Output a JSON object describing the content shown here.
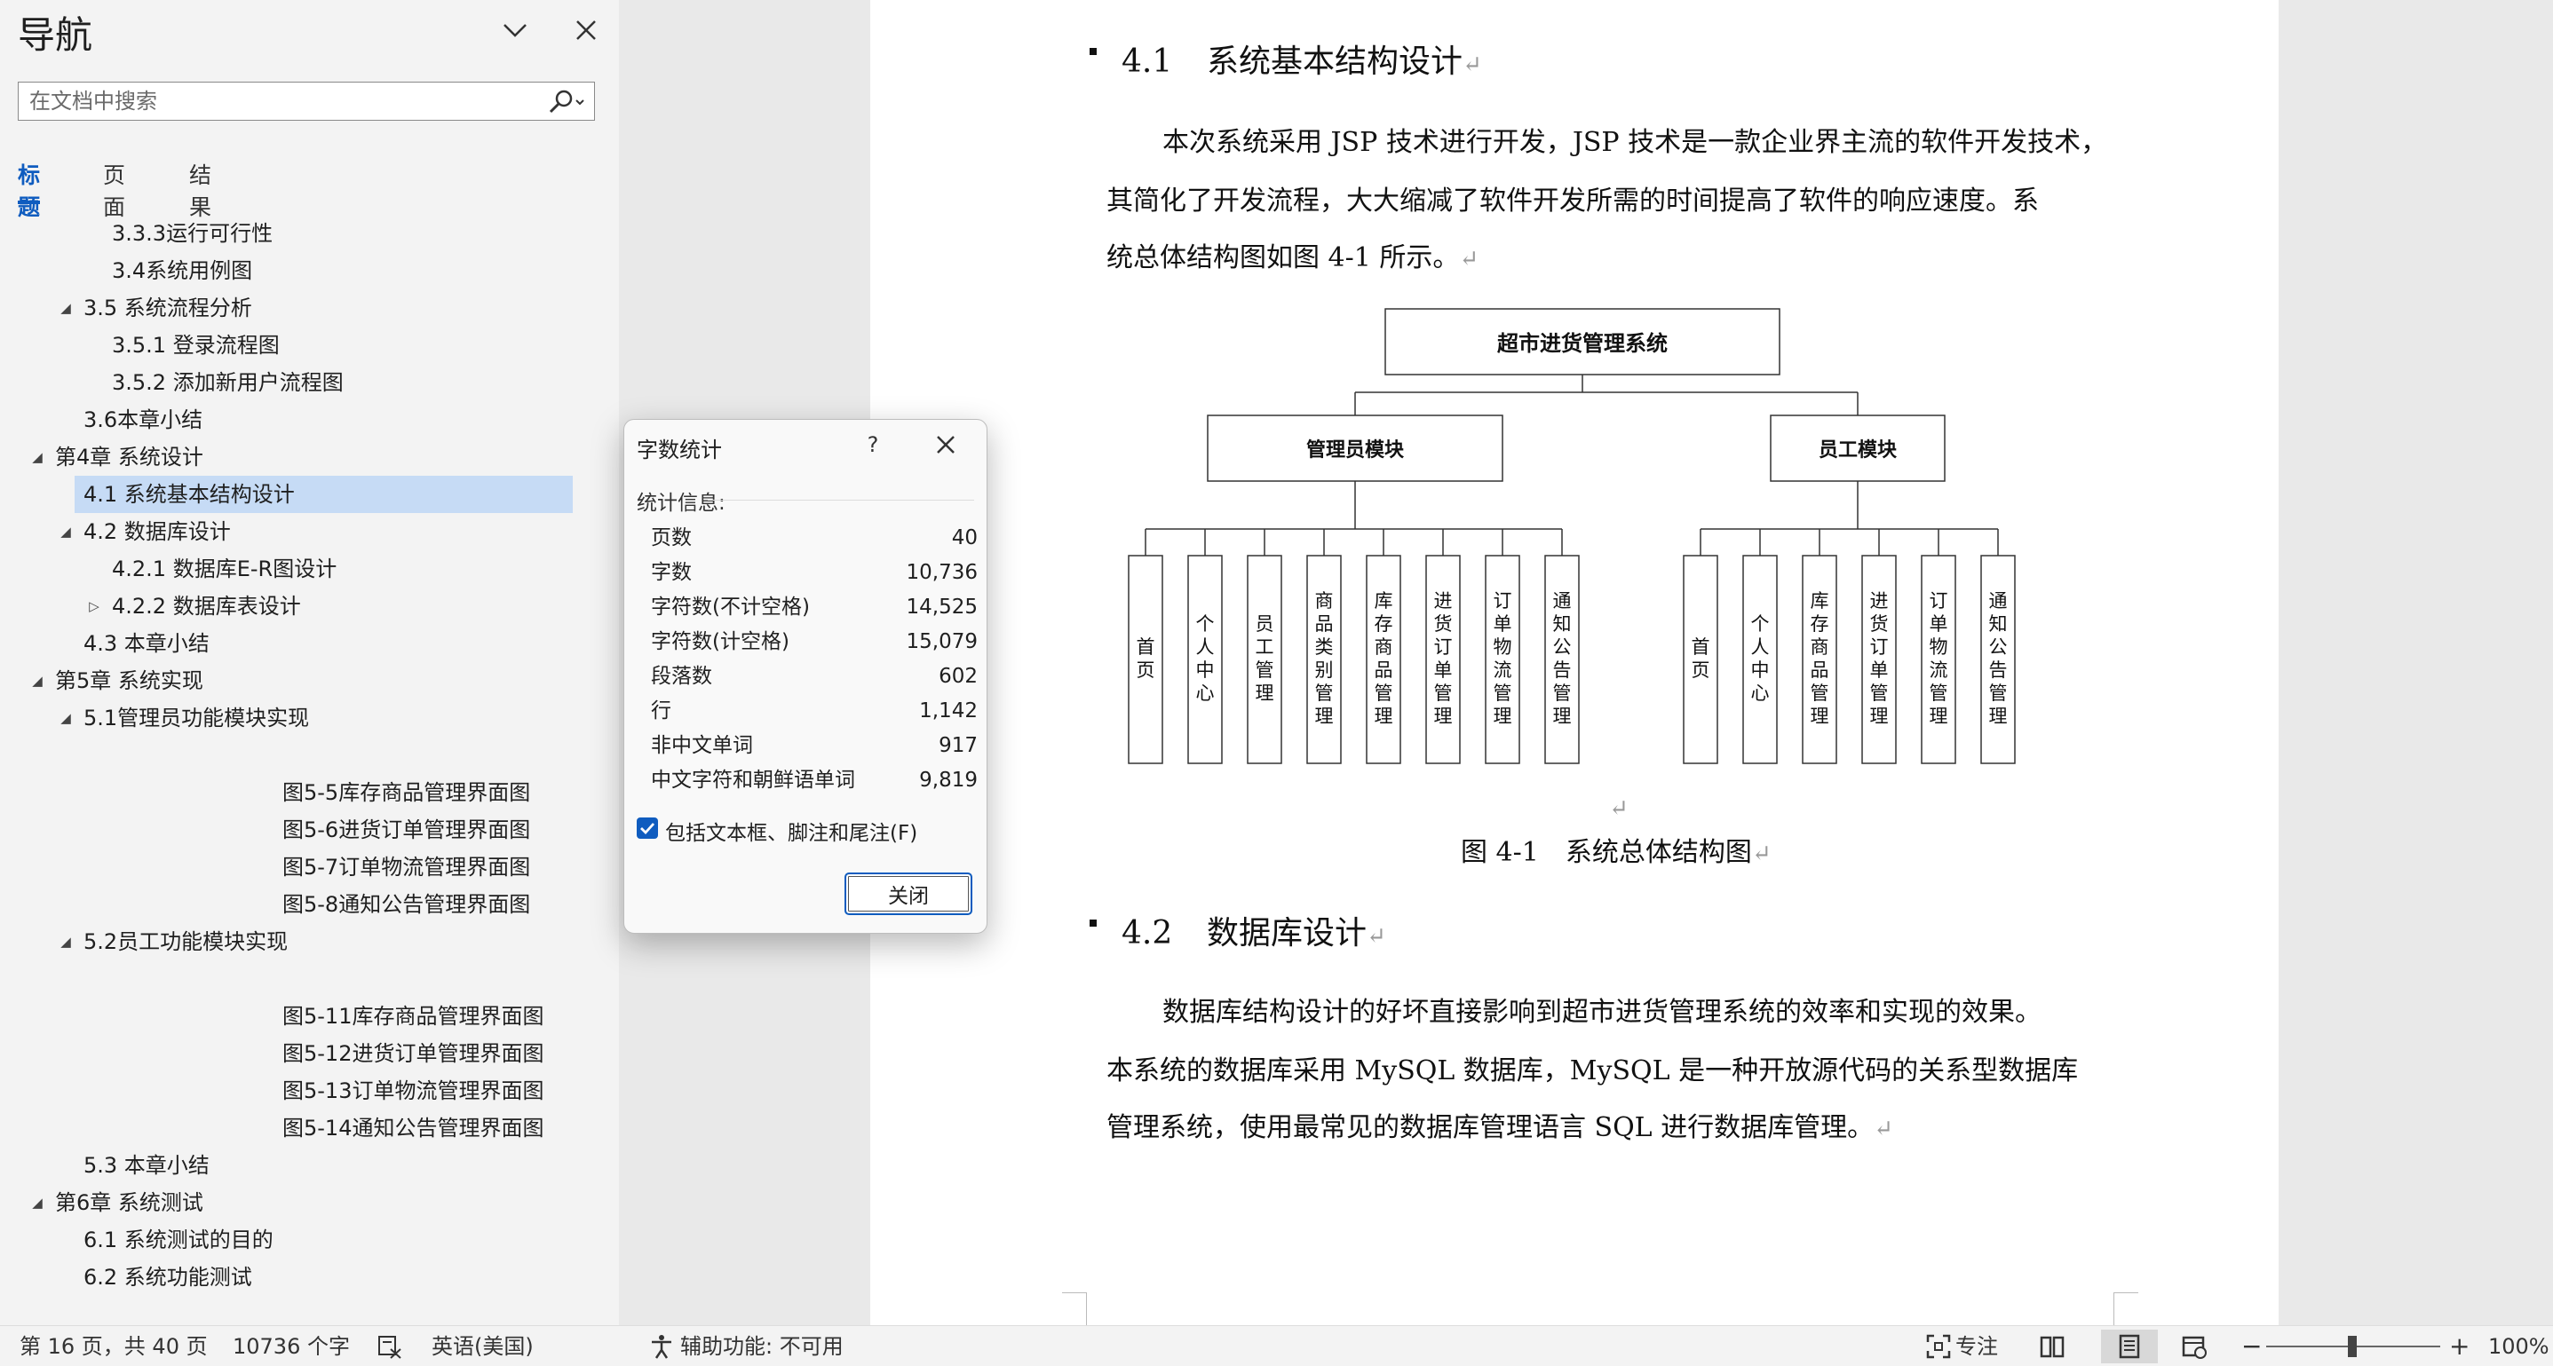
{
  "nav": {
    "title": "导航",
    "search_placeholder": "在文档中搜索",
    "tabs": [
      {
        "label": "标题",
        "active": true
      },
      {
        "label": "页面",
        "active": false
      },
      {
        "label": "结果",
        "active": false
      }
    ],
    "tree": [
      {
        "label": "3.3.3运行可行性",
        "level": 3,
        "toggle": "none"
      },
      {
        "label": "3.4系统用例图",
        "level": 3,
        "toggle": "none"
      },
      {
        "label": "3.5 系统流程分析",
        "level": 2,
        "toggle": "expanded"
      },
      {
        "label": "3.5.1 登录流程图",
        "level": 3,
        "toggle": "none"
      },
      {
        "label": "3.5.2 添加新用户流程图",
        "level": 3,
        "toggle": "none"
      },
      {
        "label": "3.6本章小结",
        "level": 2,
        "toggle": "none"
      },
      {
        "label": "第4章 系统设计",
        "level": 1,
        "toggle": "expanded"
      },
      {
        "label": "4.1 系统基本结构设计",
        "level": 2,
        "toggle": "none",
        "selected": true
      },
      {
        "label": "4.2 数据库设计",
        "level": 2,
        "toggle": "expanded"
      },
      {
        "label": "4.2.1 数据库E-R图设计",
        "level": 3,
        "toggle": "none"
      },
      {
        "label": "4.2.2 数据库表设计",
        "level": 3,
        "toggle": "collapsed"
      },
      {
        "label": "4.3 本章小结",
        "level": 2,
        "toggle": "none"
      },
      {
        "label": "第5章 系统实现",
        "level": 1,
        "toggle": "expanded"
      },
      {
        "label": "5.1管理员功能模块实现",
        "level": 2,
        "toggle": "expanded"
      },
      {
        "label": "",
        "level": 0,
        "toggle": "none"
      },
      {
        "label": "图5-5库存商品管理界面图",
        "level": 9,
        "toggle": "none"
      },
      {
        "label": "图5-6进货订单管理界面图",
        "level": 9,
        "toggle": "none"
      },
      {
        "label": "图5-7订单物流管理界面图",
        "level": 9,
        "toggle": "none"
      },
      {
        "label": "图5-8通知公告管理界面图",
        "level": 9,
        "toggle": "none"
      },
      {
        "label": "5.2员工功能模块实现",
        "level": 2,
        "toggle": "expanded"
      },
      {
        "label": "",
        "level": 0,
        "toggle": "none"
      },
      {
        "label": "图5-11库存商品管理界面图",
        "level": 9,
        "toggle": "none"
      },
      {
        "label": "图5-12进货订单管理界面图",
        "level": 9,
        "toggle": "none"
      },
      {
        "label": "图5-13订单物流管理界面图",
        "level": 9,
        "toggle": "none"
      },
      {
        "label": "图5-14通知公告管理界面图",
        "level": 9,
        "toggle": "none"
      },
      {
        "label": "5.3 本章小结",
        "level": 2,
        "toggle": "none"
      },
      {
        "label": "第6章 系统测试",
        "level": 1,
        "toggle": "expanded"
      },
      {
        "label": "6.1 系统测试的目的",
        "level": 2,
        "toggle": "none"
      },
      {
        "label": "6.2 系统功能测试",
        "level": 2,
        "toggle": "none"
      }
    ]
  },
  "document": {
    "h41": {
      "num": "4.1",
      "title": "系统基本结构设计"
    },
    "p1": [
      "本次系统采用 JSP 技术进行开发，JSP 技术是一款企业界主流的软件开发技术，",
      "其简化了开发流程，大大缩减了软件开发所需的时间提高了软件的响应速度。系",
      "统总体结构图如图 4-1 所示。"
    ],
    "figure_caption": "图 4-1　系统总体结构图",
    "h42": {
      "num": "4.2",
      "title": "数据库设计"
    },
    "p2": [
      "数据库结构设计的好坏直接影响到超市进货管理系统的效率和实现的效果。",
      "本系统的数据库采用 MySQL 数据库，MySQL 是一种开放源代码的关系型数据库",
      "管理系统，使用最常见的数据库管理语言 SQL 进行数据库管理。"
    ],
    "paragraph_mark": "↵"
  },
  "diagram": {
    "root": "超市进货管理系统",
    "branches": [
      {
        "name": "管理员模块",
        "leaves": [
          "首页",
          "个人中心",
          "员工管理",
          "商品类别管理",
          "库存商品管理",
          "进货订单管理",
          "订单物流管理",
          "通知公告管理"
        ]
      },
      {
        "name": "员工模块",
        "leaves": [
          "首页",
          "个人中心",
          "库存商品管理",
          "进货订单管理",
          "订单物流管理",
          "通知公告管理"
        ]
      }
    ]
  },
  "dialog": {
    "title": "字数统计",
    "help": "?",
    "section": "统计信息:",
    "stats": [
      {
        "label": "页数",
        "value": "40"
      },
      {
        "label": "字数",
        "value": "10,736"
      },
      {
        "label": "字符数(不计空格)",
        "value": "14,525"
      },
      {
        "label": "字符数(计空格)",
        "value": "15,079"
      },
      {
        "label": "段落数",
        "value": "602"
      },
      {
        "label": "行",
        "value": "1,142"
      },
      {
        "label": "非中文单词",
        "value": "917"
      },
      {
        "label": "中文字符和朝鲜语单词",
        "value": "9,819"
      }
    ],
    "checkbox_label": "包括文本框、脚注和尾注(F)",
    "checkbox_checked": true,
    "close_label": "关闭"
  },
  "status": {
    "page": "第 16 页，共 40 页",
    "words": "10736 个字",
    "language": "英语(美国)",
    "accessibility": "辅助功能: 不可用",
    "focus": "专注",
    "zoom_minus": "−",
    "zoom_plus": "+",
    "zoom": "100%"
  },
  "colors": {
    "accent": "#0f5cbf",
    "selection": "#c6dbf5"
  }
}
